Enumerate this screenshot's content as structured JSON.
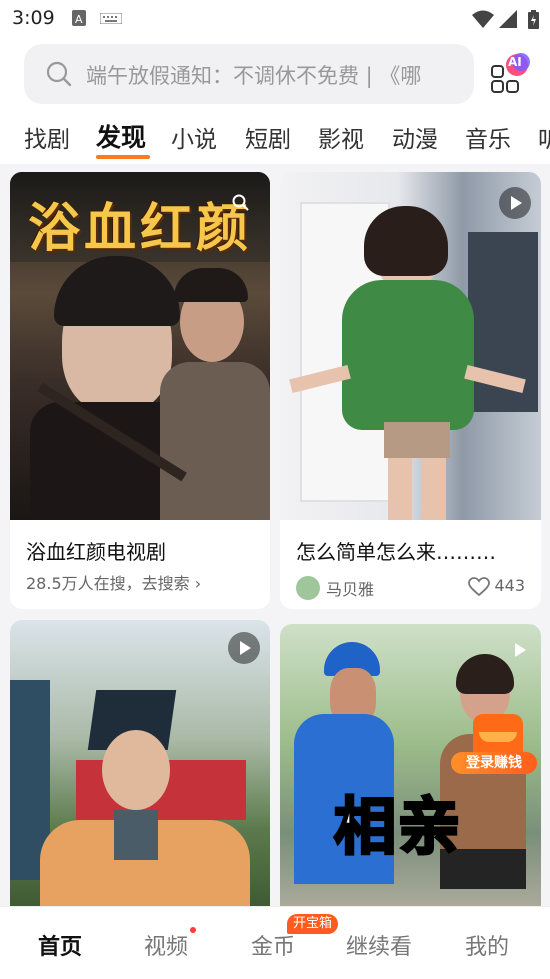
{
  "status_bar": {
    "time": "3:09"
  },
  "search": {
    "placeholder": "端午放假通知：不调休不免费 | 《哪"
  },
  "ai_button": {
    "label": "AI"
  },
  "tabs": [
    {
      "label": "找剧"
    },
    {
      "label": "发现",
      "active": true
    },
    {
      "label": "小说"
    },
    {
      "label": "短剧"
    },
    {
      "label": "影视"
    },
    {
      "label": "动漫"
    },
    {
      "label": "音乐"
    },
    {
      "label": "听"
    }
  ],
  "feed": {
    "card1": {
      "poster_text": "浴血红颜",
      "title": "浴血红颜电视剧",
      "subtitle": "28.5万人在搜，去搜索 ›"
    },
    "card2": {
      "title": "怎么简单怎么来………",
      "author": "马贝雅",
      "likes": "443"
    },
    "card4": {
      "caption": "相亲",
      "bonus_label": "登录赚钱"
    }
  },
  "bottom_nav": [
    {
      "label": "首页",
      "active": true
    },
    {
      "label": "视频",
      "dot": true
    },
    {
      "label": "金币",
      "badge": "开宝箱"
    },
    {
      "label": "继续看"
    },
    {
      "label": "我的"
    }
  ],
  "colors": {
    "accent": "#ff7a1a",
    "badge": "#ff5a1f"
  }
}
